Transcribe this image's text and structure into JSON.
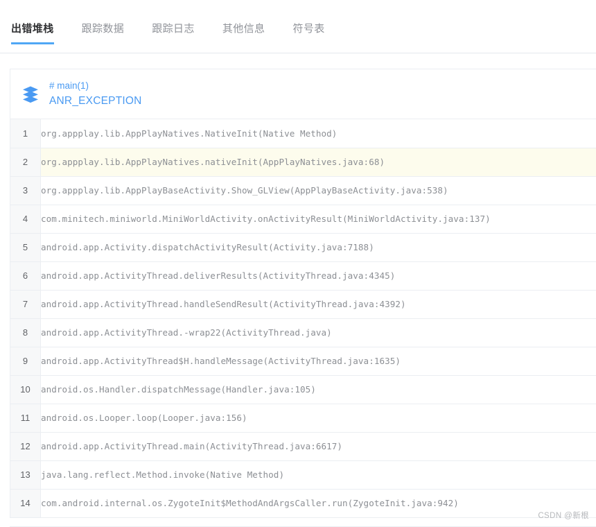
{
  "tabs": [
    {
      "label": "出错堆栈",
      "active": true
    },
    {
      "label": "跟踪数据",
      "active": false
    },
    {
      "label": "跟踪日志",
      "active": false
    },
    {
      "label": "其他信息",
      "active": false
    },
    {
      "label": "符号表",
      "active": false
    }
  ],
  "card": {
    "icon": "layers-stack-icon",
    "thread_name": "# main(1)",
    "exception_name": "ANR_EXCEPTION"
  },
  "stack_frames": [
    {
      "num": "1",
      "text": "org.appplay.lib.AppPlayNatives.NativeInit(Native Method)",
      "highlighted": false
    },
    {
      "num": "2",
      "text": "org.appplay.lib.AppPlayNatives.nativeInit(AppPlayNatives.java:68)",
      "highlighted": true
    },
    {
      "num": "3",
      "text": "org.appplay.lib.AppPlayBaseActivity.Show_GLView(AppPlayBaseActivity.java:538)",
      "highlighted": false
    },
    {
      "num": "4",
      "text": "com.minitech.miniworld.MiniWorldActivity.onActivityResult(MiniWorldActivity.java:137)",
      "highlighted": false
    },
    {
      "num": "5",
      "text": "android.app.Activity.dispatchActivityResult(Activity.java:7188)",
      "highlighted": false
    },
    {
      "num": "6",
      "text": "android.app.ActivityThread.deliverResults(ActivityThread.java:4345)",
      "highlighted": false
    },
    {
      "num": "7",
      "text": "android.app.ActivityThread.handleSendResult(ActivityThread.java:4392)",
      "highlighted": false
    },
    {
      "num": "8",
      "text": "android.app.ActivityThread.-wrap22(ActivityThread.java)",
      "highlighted": false
    },
    {
      "num": "9",
      "text": "android.app.ActivityThread$H.handleMessage(ActivityThread.java:1635)",
      "highlighted": false
    },
    {
      "num": "10",
      "text": "android.os.Handler.dispatchMessage(Handler.java:105)",
      "highlighted": false
    },
    {
      "num": "11",
      "text": "android.os.Looper.loop(Looper.java:156)",
      "highlighted": false
    },
    {
      "num": "12",
      "text": "android.app.ActivityThread.main(ActivityThread.java:6617)",
      "highlighted": false
    },
    {
      "num": "13",
      "text": "java.lang.reflect.Method.invoke(Native Method)",
      "highlighted": false
    },
    {
      "num": "14",
      "text": "com.android.internal.os.ZygoteInit$MethodAndArgsCaller.run(ZygoteInit.java:942)",
      "highlighted": false
    }
  ],
  "watermark": {
    "text": "CSDN @新根"
  },
  "colors": {
    "accent": "#4fa7f5",
    "link": "#4a9af2",
    "active_tab_text": "#303133",
    "inactive_tab_text": "#909399",
    "highlight_row": "#fdfced",
    "gutter": "#f7f8f9",
    "border": "#ebeef2",
    "mono_text": "#8c8f94"
  }
}
